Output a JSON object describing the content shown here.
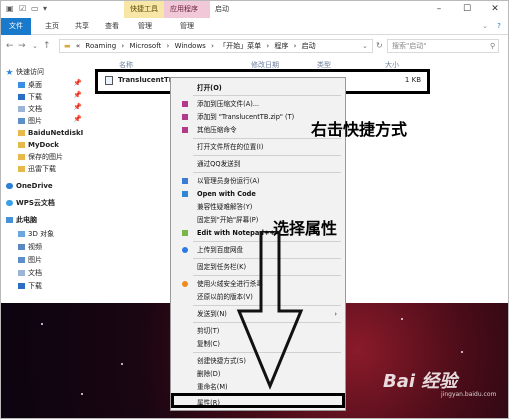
{
  "window": {
    "title": "启动",
    "context_tabs": [
      "快捷工具",
      "应用程序工具"
    ],
    "ribbon_tabs": [
      "文件",
      "主页",
      "共享",
      "查看",
      "管理",
      "管理"
    ]
  },
  "address": {
    "segments": [
      "Roaming",
      "Microsoft",
      "Windows",
      "「开始」菜单",
      "程序",
      "启动"
    ],
    "search_placeholder": "搜索\"启动\""
  },
  "nav_pane": {
    "quick_access": "快速访问",
    "items": [
      "桌面",
      "下载",
      "文档",
      "图片",
      "BaiduNetdiskI",
      "MyDock",
      "保存的图片",
      "迅雷下载"
    ],
    "onedrive": "OneDrive",
    "wps": "WPS云文档",
    "this_pc": "此电脑",
    "pc_items": [
      "3D 对象",
      "视频",
      "图片",
      "文档",
      "下载"
    ]
  },
  "columns": {
    "name": "名称",
    "date": "修改日期",
    "type": "类型",
    "size": "大小"
  },
  "file": {
    "name": "TranslucentTB",
    "size": "1 KB"
  },
  "context_menu": {
    "items": [
      "打开(O)",
      "添加到压缩文件(A)...",
      "添加到 \"TranslucentTB.zip\" (T)",
      "其他压缩命令",
      "打开文件所在的位置(I)",
      "通过QQ发送到",
      "以管理员身份运行(A)",
      "Open with Code",
      "兼容性疑难解答(Y)",
      "固定到\"开始\"屏幕(P)",
      "Edit with Notepad++",
      "上传到百度网盘",
      "固定到任务栏(K)",
      "使用火绒安全进行杀毒",
      "还原以前的版本(V)",
      "发送到(N)",
      "剪切(T)",
      "复制(C)",
      "创建快捷方式(S)",
      "删除(D)",
      "重命名(M)",
      "属性(R)"
    ]
  },
  "annotations": {
    "step1": "右击快捷方式",
    "step2": "选择属性"
  },
  "watermark": {
    "text": "Bai 经验",
    "sub": "jingyan.baidu.com"
  },
  "colors": {
    "file_tab": "#1979ca",
    "ctx_tab1": "#f7e6a6",
    "ctx_tab2": "#f1c8d8"
  }
}
